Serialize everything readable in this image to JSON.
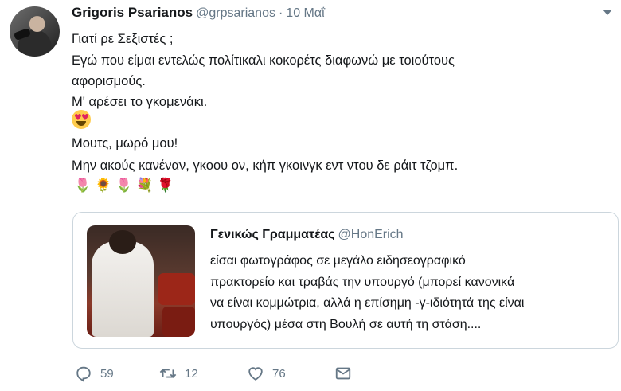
{
  "tweet": {
    "author_name": "Grigoris Psarianos",
    "author_handle": "@grpsarianos",
    "separator": "·",
    "date": "10 Μαΐ",
    "lines": [
      "Γιατί ρε Σεξιστές ;",
      "Εγώ που είμαι εντελώς πολίτικαλι κοκορέτς διαφωνώ με τοιούτους",
      "αφορισμούς.",
      "Μ' αρέσει το γκομενάκι.",
      "Μουτς, μωρό μου!",
      "Μην ακούς κανέναν, γκοου ον, κήπ γκοινγκ εντ ντου δε ράιτ τζομπ."
    ],
    "flowers": [
      "🌷",
      "🌻",
      "🌷",
      "💐",
      "🌹"
    ]
  },
  "quoted_tweet": {
    "author_name": "Γενικώς Γραμματέας",
    "author_handle": "@HonErich",
    "lines": [
      "είσαι φωτογράφος σε μεγάλο ειδησεογραφικό",
      "πρακτορείο και τραβάς την υπουργό (μπορεί κανονικά",
      "να είναι κομμώτρια, αλλά η επίσημη -γ-ιδιότητά της είναι",
      "υπουργός) μέσα στη Βουλή σε αυτή τη στάση...."
    ]
  },
  "actions": {
    "replies": "59",
    "retweets": "12",
    "likes": "76"
  },
  "icons": [
    "caret-down-icon",
    "heart-eyes-emoji",
    "reply-icon",
    "retweet-icon",
    "like-icon",
    "message-icon"
  ],
  "colors": {
    "muted": "#657786",
    "text": "#14171a",
    "border": "#ccd6dd"
  }
}
